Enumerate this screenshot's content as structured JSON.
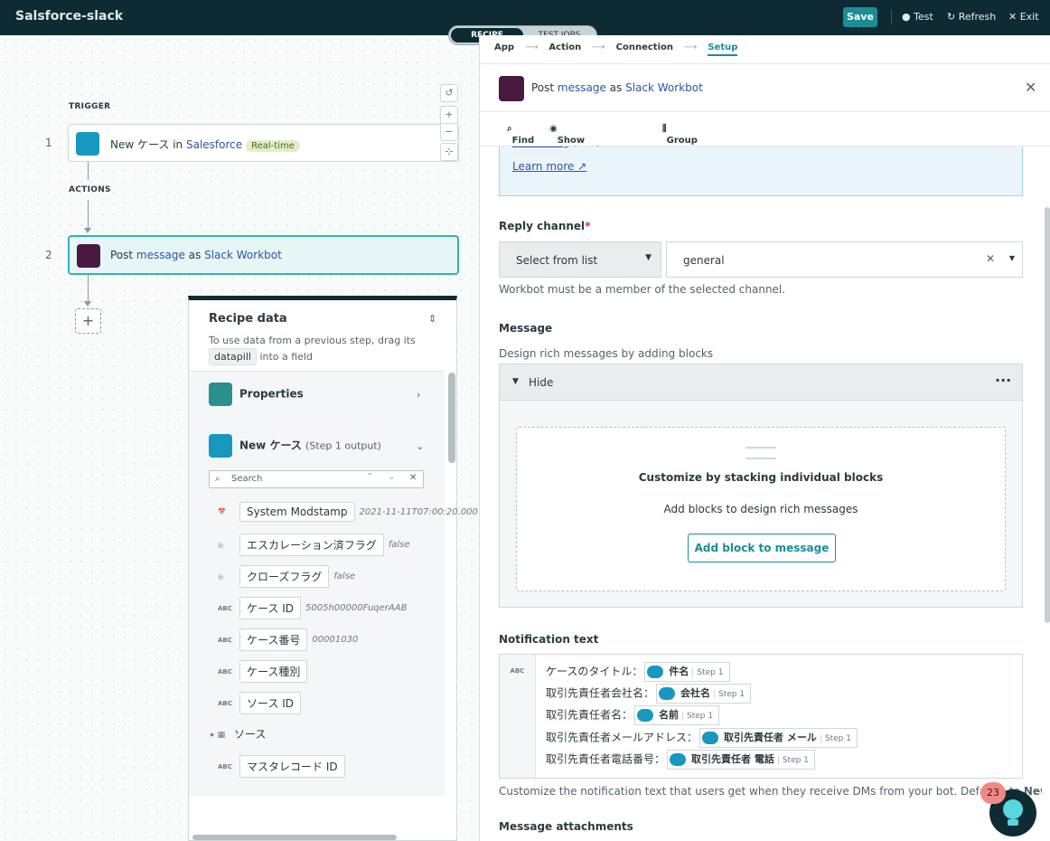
{
  "app": {
    "title": "Salsforce-slack"
  },
  "topbar": {
    "save_label": "Save",
    "test_label": "Test",
    "refresh_label": "Refresh",
    "exit_label": "Exit"
  },
  "tabs": {
    "recipe": "RECIPE",
    "test_jobs": "TEST JOBS"
  },
  "canvas": {
    "trigger_label": "TRIGGER",
    "actions_label": "ACTIONS",
    "step1": {
      "num": "1",
      "text_a": "New ケース in ",
      "app": "Salesforce",
      "badge": "Real-time"
    },
    "step2": {
      "num": "2",
      "text_a": "Post ",
      "object": "message",
      "text_b": " as ",
      "app": "Slack Workbot"
    },
    "zoom": {
      "reset": "↺",
      "in": "+",
      "out": "−",
      "fit": "⊹"
    }
  },
  "recipe_data": {
    "title": "Recipe data",
    "subtitle_a": "To use data from a previous step, drag its",
    "datapill": "datapill",
    "subtitle_b": "into a field",
    "properties_label": "Properties",
    "step_output_name": "New ケース",
    "step_output_sub": "(Step 1 output)",
    "search_placeholder": "Search",
    "fields": [
      {
        "icon": "calendar-icon",
        "type": "📅",
        "name": "System Modstamp",
        "value": "2021-11-11T07:00:20.000"
      },
      {
        "icon": "toggle-icon",
        "type": "◎",
        "name": "エスカレーション済フラグ",
        "value": "false"
      },
      {
        "icon": "toggle-icon",
        "type": "◎",
        "name": "クローズフラグ",
        "value": "false"
      },
      {
        "icon": "text-icon",
        "type": "ABC",
        "name": "ケース ID",
        "value": "5005h00000FuqerAAB"
      },
      {
        "icon": "text-icon",
        "type": "ABC",
        "name": "ケース番号",
        "value": "00001030"
      },
      {
        "icon": "text-icon",
        "type": "ABC",
        "name": "ケース種別",
        "value": ""
      },
      {
        "icon": "text-icon",
        "type": "ABC",
        "name": "ソース ID",
        "value": ""
      },
      {
        "icon": "grid-icon",
        "type": "▸ ▦",
        "name": "ソース",
        "value": ""
      },
      {
        "icon": "text-icon",
        "type": "ABC",
        "name": "マスタレコード ID",
        "value": ""
      }
    ]
  },
  "panel": {
    "crumbs": [
      "App",
      "Action",
      "Connection",
      "Setup"
    ],
    "header_a": "Post ",
    "header_object": "message",
    "header_b": " as ",
    "header_app": "Slack Workbot",
    "tools": {
      "find": "Find",
      "optional": "Show optional fields",
      "group": "Group map data"
    },
    "info_link1": "formatting",
    "info_link1_suffix": ".",
    "info_link2": "Learn more",
    "reply_label": "Reply channel",
    "reply_required": "*",
    "reply_mode": "Select from list",
    "reply_value": "general",
    "reply_hint": "Workbot must be a member of the selected channel.",
    "message_label": "Message",
    "message_hint": "Design rich messages by adding blocks",
    "hide_label": "Hide",
    "blocks_title": "Customize by stacking individual blocks",
    "blocks_sub": "Add blocks to design rich messages",
    "add_block_label": "Add block to message",
    "notif_label": "Notification text",
    "notif_type": "ABC",
    "notif_lines": [
      {
        "prefix": "ケースのタイトル：",
        "pill": "件名",
        "step": "Step 1"
      },
      {
        "prefix": "取引先責任者会社名：",
        "pill": "会社名",
        "step": "Step 1"
      },
      {
        "prefix": "取引先責任者名：",
        "pill": "名前",
        "step": "Step 1"
      },
      {
        "prefix": "取引先責任者メールアドレス：",
        "pill": "取引先責任者 メール",
        "step": "Step 1"
      },
      {
        "prefix": "取引先責任者電話番号：",
        "pill": "取引先責任者 電話",
        "step": "Step 1"
      }
    ],
    "notif_hint_a": "Customize the notification text that users get when they receive DMs from your bot. Defaults to ",
    "notif_hint_b": "New m",
    "attachments_label": "Message attachments"
  },
  "help": {
    "badge_count": "23"
  }
}
